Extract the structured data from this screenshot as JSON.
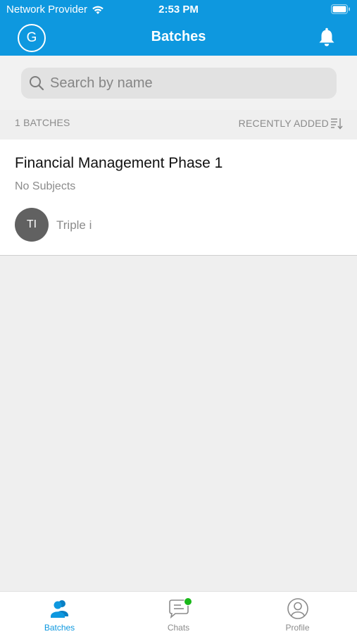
{
  "status_bar": {
    "carrier": "Network Provider",
    "time": "2:53 PM",
    "icons": [
      "wifi-icon",
      "battery-icon"
    ]
  },
  "header": {
    "avatar_initial": "G",
    "title": "Batches",
    "bell_icon": "bell-icon"
  },
  "search": {
    "placeholder": "Search by name",
    "value": ""
  },
  "list": {
    "count_label": "1 BATCHES",
    "sort_label": "RECENTLY ADDED",
    "sort_icon": "sort-icon",
    "items": [
      {
        "title": "Financial Management Phase 1",
        "subtitle": "No Subjects",
        "owner_initials": "TI",
        "owner_name": "Triple i"
      }
    ]
  },
  "tabbar": {
    "tabs": [
      {
        "label": "Batches",
        "icon": "batches-icon",
        "active": true
      },
      {
        "label": "Chats",
        "icon": "chat-icon",
        "active": false,
        "badge": true
      },
      {
        "label": "Profile",
        "icon": "profile-icon",
        "active": false
      }
    ]
  },
  "colors": {
    "primary": "#0e98df",
    "background": "#efefef",
    "badge": "#19b819",
    "avatar": "#616161"
  }
}
